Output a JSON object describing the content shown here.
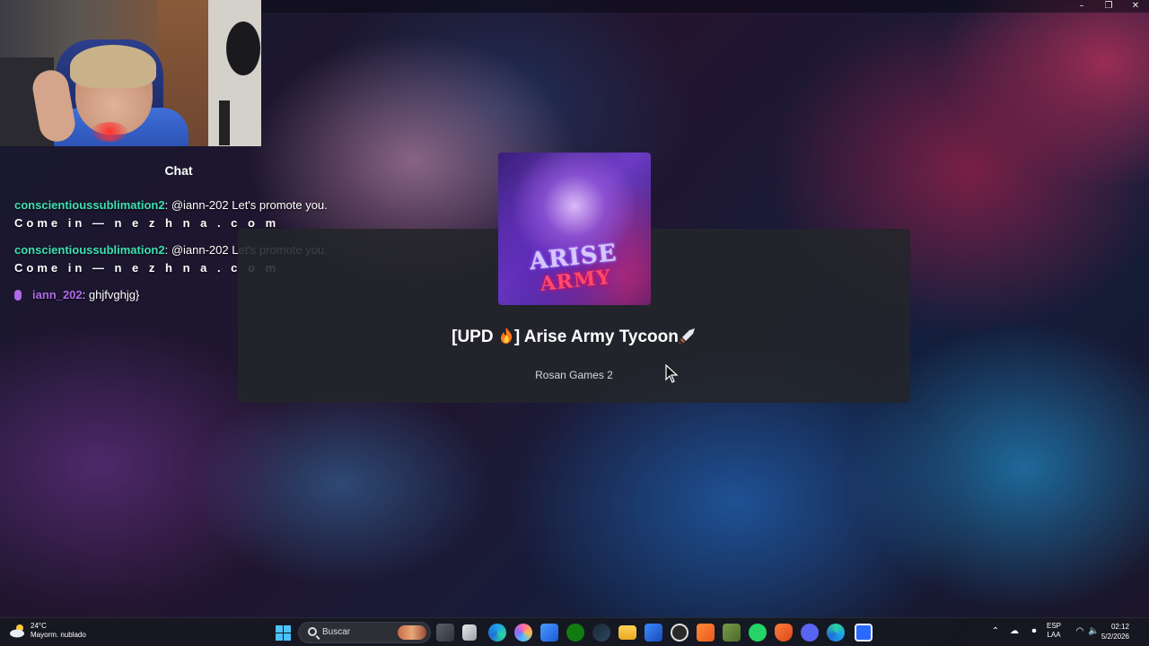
{
  "window": {
    "controls": [
      "–",
      "❐",
      "✕"
    ]
  },
  "chat": {
    "title": "Chat",
    "messages": [
      {
        "user": "conscientioussublimation2",
        "text": " @iann-202 Let's promote you.",
        "line2": "Come in — n e z h n a . c o m"
      },
      {
        "user": "conscientioussublimation2",
        "text": " @iann-202 Let's promote you.",
        "line2": "Come in — n e z h n a . c o m"
      },
      {
        "user": "iann_202",
        "text": " ghjfvghjg}",
        "role": "mic-icon"
      }
    ],
    "colors": {
      "user": "#3fe0b0",
      "mod": "#b06ae8"
    }
  },
  "game": {
    "title_prefix": "[UPD ",
    "title_main": "] Arise Army Tycoon",
    "creator": "Rosan Games 2",
    "thumbnail_text_1": "ARISE",
    "thumbnail_text_2": "ARMY"
  },
  "taskbar": {
    "weather": {
      "temp": "24°C",
      "condition": "Mayorm. nublado"
    },
    "search_placeholder": "Buscar",
    "apps": [
      "file-explorer-icon",
      "notepad-icon",
      "edge-icon",
      "copilot-icon",
      "store-icon",
      "xbox-icon",
      "steam-icon",
      "folder-icon",
      "mail-icon",
      "obs-icon",
      "cheat-icon",
      "minecraft-icon",
      "whatsapp-icon",
      "brave-icon",
      "discord-icon",
      "edge-dev-icon",
      "roblox-icon"
    ],
    "language": "ESP",
    "layout": "LAA",
    "time": "02:12",
    "date": "5/2/2026"
  }
}
